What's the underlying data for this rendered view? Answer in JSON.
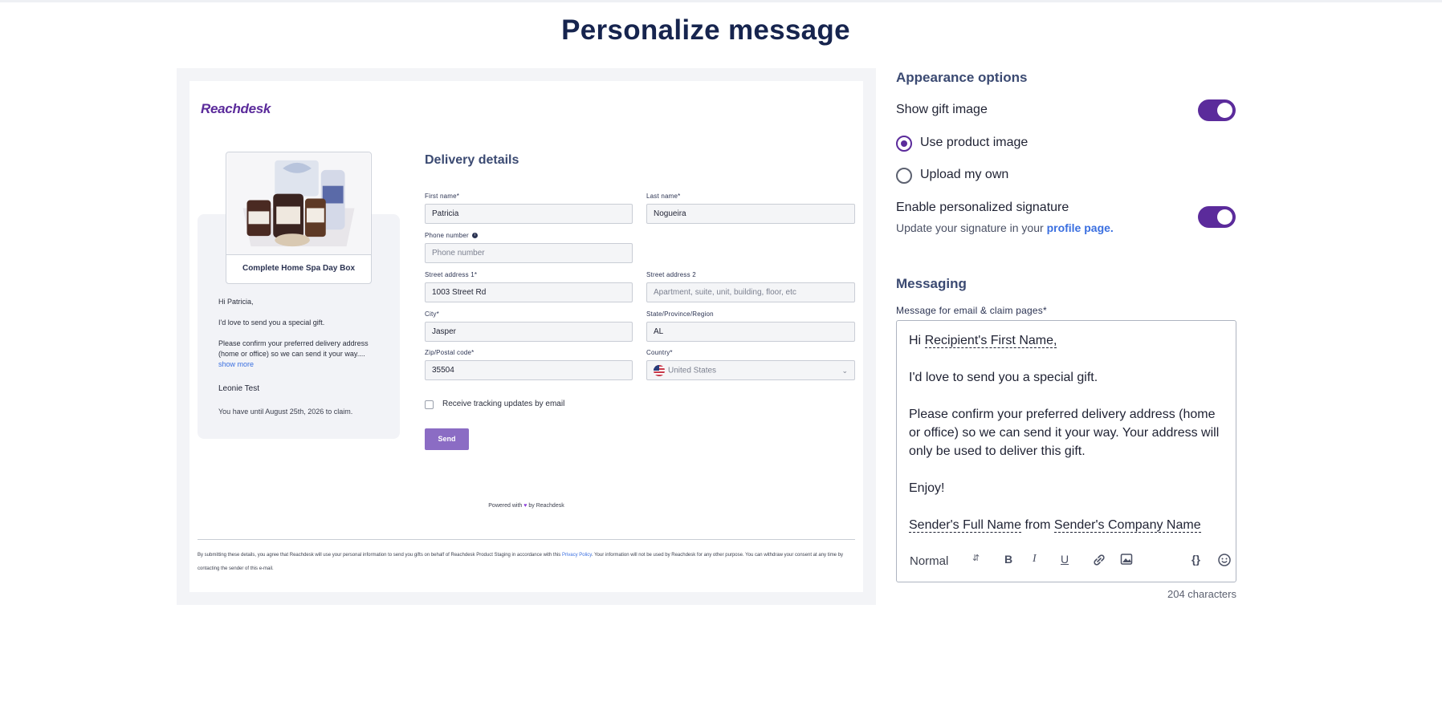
{
  "page": {
    "title": "Personalize message"
  },
  "preview": {
    "logo": "Reachdesk",
    "gift_name": "Complete Home Spa Day Box",
    "message_lines": [
      "Hi Patricia,",
      "I'd love to send you a special gift.",
      "Please confirm your preferred delivery address (home or office) so we can send it your way...."
    ],
    "show_more": "show more",
    "sender": "Leonie Test",
    "claim_deadline": "You have until August 25th, 2026 to claim.",
    "delivery": {
      "title": "Delivery details",
      "first_name": {
        "label": "First name*",
        "value": "Patricia"
      },
      "last_name": {
        "label": "Last name*",
        "value": "Nogueira"
      },
      "phone": {
        "label": "Phone number",
        "placeholder": "Phone number"
      },
      "street1": {
        "label": "Street address 1*",
        "value": "1003 Street Rd"
      },
      "street2": {
        "label": "Street address 2",
        "placeholder": "Apartment, suite, unit, building, floor, etc"
      },
      "city": {
        "label": "City*",
        "value": "Jasper"
      },
      "state": {
        "label": "State/Province/Region",
        "value": "AL"
      },
      "zip": {
        "label": "Zip/Postal code*",
        "value": "35504"
      },
      "country": {
        "label": "Country*",
        "value": "United States"
      },
      "tracking_label": "Receive tracking updates by email",
      "send": "Send"
    },
    "powered_prefix": "Powered with",
    "powered_suffix": "by Reachdesk",
    "disclaimer_a": "By submitting these details, you agree that Reachdesk will use your personal information to send you gifts on behalf of Reachdesk Product Staging in accordance with this",
    "disclaimer_link": "Privacy Policy",
    "disclaimer_b": ". Your information will not be used by Reachdesk for any other purpose. You can withdraw your consent at any time by contacting the sender of this e-mail."
  },
  "appearance": {
    "title": "Appearance options",
    "show_gift_image": "Show gift image",
    "use_product_image": "Use product image",
    "upload_own": "Upload my own",
    "enable_signature": "Enable personalized signature",
    "signature_sub_prefix": "Update your signature in your",
    "signature_link": "profile page.",
    "show_gift_image_on": true,
    "signature_on": true
  },
  "messaging": {
    "title": "Messaging",
    "field_label": "Message for email & claim pages*",
    "greeting_prefix": "Hi",
    "token_first_name": "Recipient's First Name,",
    "line2": "I'd love to send you a special gift.",
    "line3": "Please confirm your preferred delivery address (home or office) so we can send it your way. Your address will only be used to deliver this gift.",
    "line4": "Enjoy!",
    "token_sender": "Sender's Full Name",
    "from_word": "from",
    "token_company": "Sender's Company Name",
    "format_select": "Normal",
    "char_count": "204 characters"
  },
  "colors": {
    "brand": "#5b2b9b",
    "heading": "#16244e",
    "link": "#3a6fe0",
    "send_button": "#8b6cc4"
  },
  "icons": [
    "bold-icon",
    "italic-icon",
    "underline-icon",
    "link-icon",
    "image-icon",
    "braces-icon",
    "emoji-icon",
    "info-icon",
    "us-flag-icon",
    "chevron-down-icon",
    "heart-icon"
  ]
}
